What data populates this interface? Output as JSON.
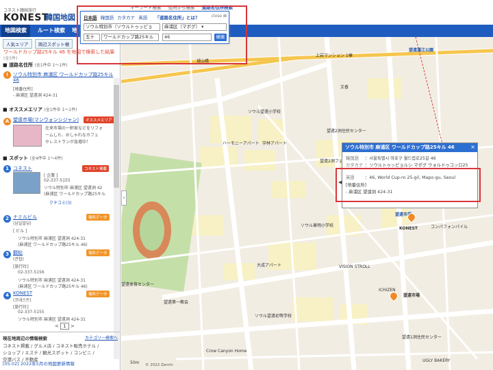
{
  "header": {
    "logo_sub": "コネスト韓国旅行",
    "logo": "KONEST",
    "logo_kr": "韓国地図",
    "top_links": [
      "キーワード検索",
      "住所から検索",
      "道路名住所検索"
    ]
  },
  "navbar": {
    "tabs": [
      "地図検索",
      "ルート検索",
      "地"
    ]
  },
  "sidebar": {
    "subtabs": [
      "人気エリア",
      "周辺スポット検"
    ],
    "result_title": "ワールドカップ路25キル 46 を地図で検索した結果",
    "result_count": "(全5件)",
    "road_section": {
      "title": "道路名住所",
      "count": "(全1件中 1〜1件)"
    },
    "road_item": {
      "pin": "!",
      "title_1": "ソウル特別市 麻浦区 ワールドカップ路25キル",
      "title_2": "46",
      "line_1": "[地番住所]",
      "line_2": "- 麻浦区 望遠洞 424-31"
    },
    "area_section": {
      "title": "オススメエリア",
      "count": "(全1件中 1〜1件)"
    },
    "area_item": {
      "pin": "A",
      "title": "望遠市場(マンウォンシジャン)",
      "badge": "オススメエリア",
      "desc_1": "在来市場の一軒家などをリフォ",
      "desc_2": "ームした、おしゃれなカフェ",
      "desc_3": "やレストランが急増中！"
    },
    "spot_section": {
      "title": "スポット",
      "count": "(全4件中 1〜4件)"
    },
    "spots": [
      {
        "pin": "1",
        "title": "コネスト",
        "badge": "コネスト掲載",
        "lines": [
          "[ 企業 ]",
          "02-337-5155",
          "ソウル特別市 麻浦区 望遠洞 42",
          "(麻浦区 ワールドカップ路25キル",
          "クチコミ(3)"
        ]
      },
      {
        "pin": "2",
        "title": "ナミルビル",
        "kr": "(남일빌딩)",
        "badge": "場所データ",
        "lines": [
          "[ ビル ]",
          "ソウル特別市 麻浦区 望遠洞 424-31",
          "(麻浦区 ワールドカップ路25キル 46)"
        ]
      },
      {
        "pin": "3",
        "title": "觀帖",
        "kr": "(관첩)",
        "badge": "場所データ",
        "lines": [
          "[旅行社]",
          "02-337-5156",
          "ソウル特別市 麻浦区 望遠洞 424-31",
          "(麻浦区 ワールドカップ路25キル 46)"
        ]
      },
      {
        "pin": "4",
        "title": "KONEST",
        "kr": "(코네스트)",
        "badge": "場所データ",
        "lines": [
          "[旅行社]",
          "02-337-5155",
          "ソウル特別市 麻浦区 望遠洞 424-31",
          "(麻浦区 ワールドカップ路25キル 46)"
        ]
      }
    ],
    "pager": {
      "prev": "<",
      "current": "1",
      "next": ">"
    },
    "bottom": {
      "title": "現在地周辺の情報検索",
      "category_link": "カテゴリー検索へ",
      "links_1": "コネスト掲載 / グルメ店 / コネスト販売ホテル /",
      "links_2": "ショップ / エステ / 観光スポット / コンビニ /",
      "links_3": "空港バス / 不動産"
    },
    "news": "[05.02] 2022年5月の地図更新情報"
  },
  "search_popup": {
    "tabs": [
      "日本語",
      "韓国語",
      "カタカナ",
      "英語"
    ],
    "question": "「道路名住所」とは？",
    "close": "close",
    "city": "ソウル特別市（ソウルトゥッピョ",
    "district": "麻浦区（マポグ）",
    "sort": "五十",
    "road": "ワールドカップ路25キル",
    "number": "46",
    "button": "検索"
  },
  "info_popup": {
    "title": "ソウル特別市 麻浦区 ワールドカップ路25キル 46",
    "close": "×",
    "rows": [
      {
        "k": "韓国語",
        "v": "：서울특별시 마포구 월드컵로25길 46"
      },
      {
        "k": "カタカナ",
        "v": "：ソウルトゥッピョルシ マポグ ウォルドゥコッロ25"
      },
      {
        "k": "英語",
        "v": "：46, World Cup-ro 25-gil, Mapo-gu, Seoul"
      },
      {
        "k": "",
        "v": "[地番住所]"
      },
      {
        "k": "",
        "v": "- 麻浦区 望遠洞 424-31"
      }
    ]
  },
  "map": {
    "labels": [
      "上岩マンション 1棟",
      "文香",
      "望遠漢江公園",
      "ソウル望遠小学校",
      "望遠2洞住民センター",
      "望遠2洞フェイス",
      "ハーモニーアパート",
      "宇林アパート",
      "ソウル東明小学校",
      "望遠市場",
      "コンパフォンパイル",
      "KONEST",
      "VISION STROLL",
      "望遠体育センター",
      "望遠第一教会",
      "Crow Canyon Home",
      "望遠1洞住民センター",
      "UGLY BAKERY",
      "城山橋",
      "ICHIZEN",
      "大成アパート",
      "ソウル望遠初等学校"
    ],
    "marker_labels": [
      "KONEST",
      "望遠市場"
    ],
    "scale": "50m",
    "copyright": "© 2022 Zenrin"
  }
}
